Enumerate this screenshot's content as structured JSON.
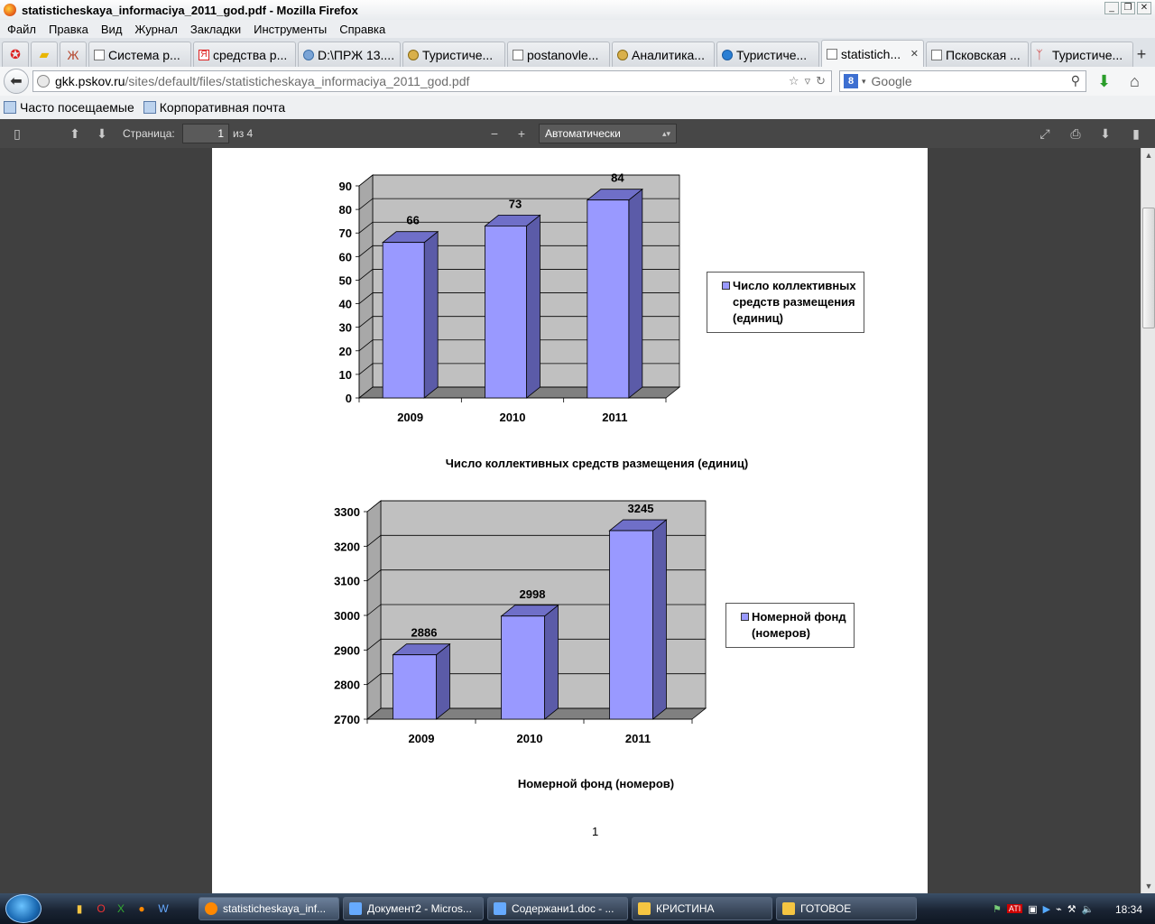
{
  "window": {
    "title": "statisticheskaya_informaciya_2011_god.pdf - Mozilla Firefox"
  },
  "menu": [
    "Файл",
    "Правка",
    "Вид",
    "Журнал",
    "Закладки",
    "Инструменты",
    "Справка"
  ],
  "tabs": [
    {
      "label": "Система р...",
      "icon": "page"
    },
    {
      "label": "средства р...",
      "icon": "yandex"
    },
    {
      "label": "D:\\ПРЖ 13....",
      "icon": "drive"
    },
    {
      "label": "Туристиче...",
      "icon": "crest"
    },
    {
      "label": "postanovle...",
      "icon": "page"
    },
    {
      "label": "Аналитика...",
      "icon": "crest"
    },
    {
      "label": "Туристиче...",
      "icon": "flower"
    },
    {
      "label": "statistich...",
      "icon": "page",
      "active": true
    },
    {
      "label": "Псковская ...",
      "icon": "page"
    },
    {
      "label": "Туристиче...",
      "icon": "logo"
    }
  ],
  "url": {
    "host": "gkk.pskov.ru",
    "path": "/sites/default/files/statisticheskaya_informaciya_2011_god.pdf"
  },
  "search": {
    "placeholder": "Google"
  },
  "bookmarks": [
    {
      "label": "Часто посещаемые"
    },
    {
      "label": "Корпоративная почта"
    }
  ],
  "pdf_toolbar": {
    "page_label": "Страница:",
    "page_value": "1",
    "page_of": "из 4",
    "zoom": "Автоматически"
  },
  "page_number": "1",
  "chart_data": [
    {
      "type": "bar",
      "title": "Число коллективных средств размещения (единиц)",
      "categories": [
        "2009",
        "2010",
        "2011"
      ],
      "series": [
        {
          "name": "Число коллективных средств размещения (единиц)",
          "values": [
            66,
            73,
            84
          ]
        }
      ],
      "legend_lines": [
        "Число коллективных",
        "средств размещения",
        "(единиц)"
      ],
      "ylim": [
        0,
        90
      ],
      "yticks": [
        0,
        10,
        20,
        30,
        40,
        50,
        60,
        70,
        80,
        90
      ],
      "grid": true,
      "legend": "right",
      "bar_color": "#9999ff",
      "bar_side_color": "#5b5ba8"
    },
    {
      "type": "bar",
      "title": "Номерной фонд (номеров)",
      "categories": [
        "2009",
        "2010",
        "2011"
      ],
      "series": [
        {
          "name": "Номерной фонд (номеров)",
          "values": [
            2886,
            2998,
            3245
          ]
        }
      ],
      "legend_lines": [
        "Номерной фонд",
        "(номеров)"
      ],
      "ylim": [
        2700,
        3300
      ],
      "yticks": [
        2700,
        2800,
        2900,
        3000,
        3100,
        3200,
        3300
      ],
      "grid": true,
      "legend": "right",
      "bar_color": "#9999ff",
      "bar_side_color": "#5b5ba8"
    }
  ],
  "taskbar": {
    "tasks": [
      {
        "label": "statisticheskaya_inf...",
        "icon": "firefox",
        "active": true
      },
      {
        "label": "Документ2 - Micros...",
        "icon": "word"
      },
      {
        "label": "Содержани1.doc - ...",
        "icon": "word"
      },
      {
        "label": "КРИСТИНА",
        "icon": "folder"
      },
      {
        "label": "ГОТОВОЕ",
        "icon": "folder"
      }
    ],
    "clock": "18:34"
  }
}
